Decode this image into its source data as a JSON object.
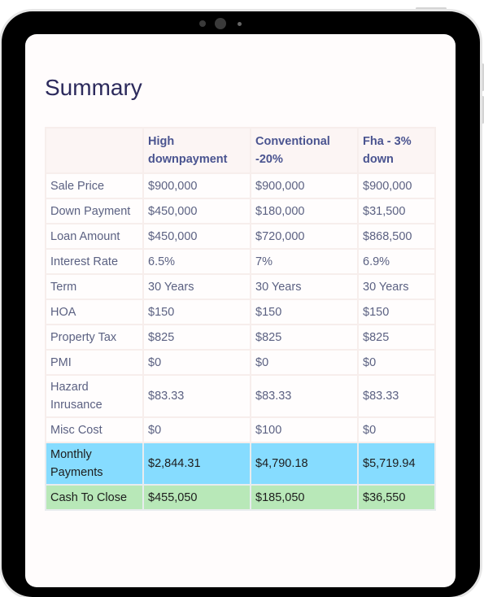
{
  "page": {
    "title": "Summary"
  },
  "table": {
    "columns": [
      "",
      "High downpayment",
      "Conventional -20%",
      "Fha - 3% down"
    ],
    "rows": [
      {
        "label": "Sale Price",
        "values": [
          "$900,000",
          "$900,000",
          "$900,000"
        ]
      },
      {
        "label": "Down Payment",
        "values": [
          "$450,000",
          "$180,000",
          "$31,500"
        ]
      },
      {
        "label": "Loan Amount",
        "values": [
          "$450,000",
          "$720,000",
          "$868,500"
        ]
      },
      {
        "label": "Interest Rate",
        "values": [
          "6.5%",
          "7%",
          "6.9%"
        ]
      },
      {
        "label": "Term",
        "values": [
          "30 Years",
          "30 Years",
          "30 Years"
        ]
      },
      {
        "label": "HOA",
        "values": [
          "$150",
          "$150",
          "$150"
        ]
      },
      {
        "label": "Property Tax",
        "values": [
          "$825",
          "$825",
          "$825"
        ]
      },
      {
        "label": "PMI",
        "values": [
          "$0",
          "$0",
          "$0"
        ]
      },
      {
        "label": "Hazard Inrusance",
        "values": [
          "$83.33",
          "$83.33",
          "$83.33"
        ]
      },
      {
        "label": "Misc Cost",
        "values": [
          "$0",
          "$100",
          "$0"
        ]
      },
      {
        "label": "Monthly Payments",
        "values": [
          "$2,844.31",
          "$4,790.18",
          "$5,719.94"
        ]
      },
      {
        "label": "Cash To Close",
        "values": [
          "$455,050",
          "$185,050",
          "$36,550"
        ]
      }
    ]
  },
  "colors": {
    "monthly_row": "#86dcff",
    "cash_row": "#b8e8b8",
    "header_text": "#4a5490",
    "title_text": "#2c2a5c"
  },
  "device": {
    "camera_icon": "camera-icon",
    "sensor_icon": "sensor-icon"
  }
}
